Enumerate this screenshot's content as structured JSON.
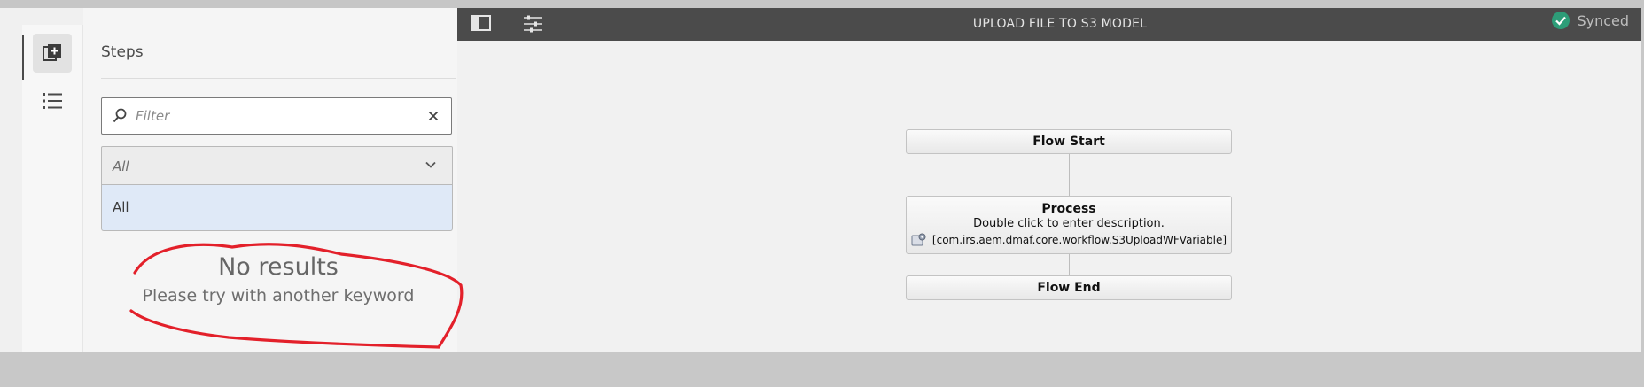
{
  "header": {
    "title": "UPLOAD FILE TO S3 MODEL",
    "sync_status": "Synced"
  },
  "rail": {
    "items": [
      {
        "icon": "add-step-icon",
        "active": true
      },
      {
        "icon": "list-icon",
        "active": false
      }
    ]
  },
  "steps_panel": {
    "title": "Steps",
    "filter": {
      "placeholder": "Filter",
      "value": ""
    },
    "group_select": {
      "selected": "All",
      "options": [
        "All"
      ]
    },
    "empty_state": {
      "title": "No results",
      "subtitle": "Please try with another keyword"
    }
  },
  "workflow": {
    "nodes": [
      {
        "type": "start",
        "title": "Flow Start"
      },
      {
        "type": "process",
        "title": "Process",
        "description": "Double click to enter description.",
        "implementation": "[com.irs.aem.dmaf.core.workflow.S3UploadWFVariable]"
      },
      {
        "type": "end",
        "title": "Flow End"
      }
    ]
  },
  "colors": {
    "header_bg": "#4b4b4b",
    "canvas_bg": "#f1f1f1",
    "synced_green": "#2d9d78",
    "annotation_red": "#e3202a",
    "selected_option_bg": "#dfe9f7"
  }
}
